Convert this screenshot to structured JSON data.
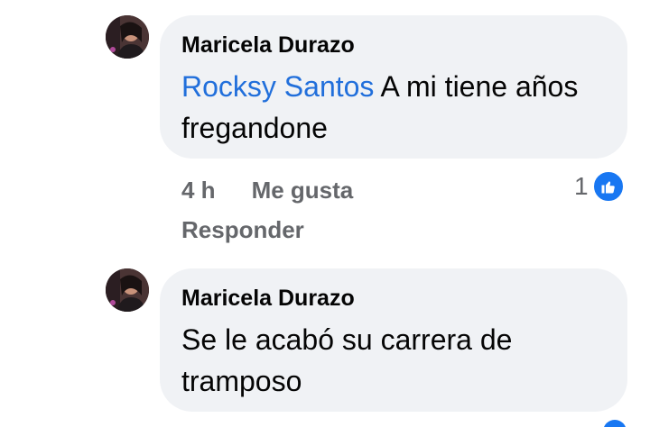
{
  "comments": [
    {
      "author": "Maricela Durazo",
      "mention": "Rocksy Santos",
      "text": " A mi tiene años fregandone",
      "time": "4 h",
      "like_label": "Me gusta",
      "reply_label": "Responder",
      "reaction_count": "1",
      "reaction_icon": "like-icon"
    },
    {
      "author": "Maricela Durazo",
      "text": "Se le acabó su carrera de tramposo"
    }
  ],
  "colors": {
    "bubble": "#f0f2f5",
    "mention": "#216fdb",
    "meta": "#65676b",
    "like": "#1877f2"
  }
}
